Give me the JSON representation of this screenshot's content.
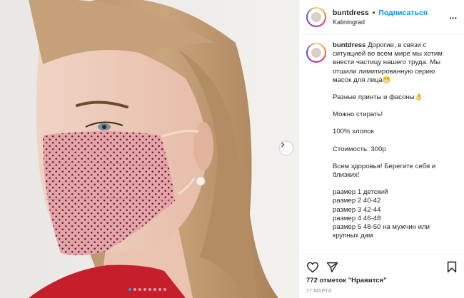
{
  "post": {
    "username": "buntdress",
    "separator": "•",
    "follow_label": "Подписаться",
    "location": "Kaliningrad",
    "more_icon": "more-dots-icon",
    "caption_lines": [
      "Дорогие, в связи с ситуацией во всем мире мы хотим внести частицу нашего труда. Мы отшили лимитированную серию масок для лица😁",
      "Разные принты и фасоны👌",
      "Можно стирать!",
      "100% хлопок",
      "Стоимость: 300р",
      "Всем здоровья! Берегите себя и близких!"
    ],
    "sizes": [
      "размер 1 детский",
      "размер 2 40-42",
      "размер 3 42-44",
      "размер 4 46-48",
      "размер 5 48-50 на мужчин или крупных дам"
    ],
    "likes_label": "772 отметок \"Нравится\"",
    "date": "17 МАРТА"
  },
  "carousel": {
    "slide_count": 8,
    "active_index": 0
  },
  "colors": {
    "follow": "#0095f6",
    "mask": "#e8a4a8",
    "dot_active": "#1da1f2"
  }
}
